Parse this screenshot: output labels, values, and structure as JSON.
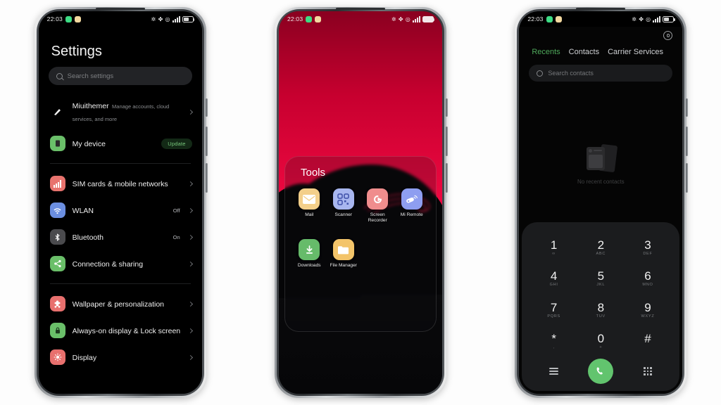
{
  "background_color": "#fdfdfd",
  "status_bar": {
    "time": "22:03",
    "left_icons": [
      "phone-notification-icon",
      "app-notification-icon"
    ],
    "right_icons": [
      "bluetooth-icon",
      "nfc-icon",
      "dnd-icon",
      "signal-bars-icon",
      "battery-icon"
    ]
  },
  "phone1": {
    "title": "Settings",
    "search": {
      "placeholder": "Search settings",
      "icon": "search-icon"
    },
    "groups": [
      {
        "items": [
          {
            "icon": "miuithemer-icon",
            "icon_color": "transparent",
            "label": "Miuithemer",
            "sub": "Manage accounts, cloud services, and more",
            "value": "",
            "badge": "",
            "chevron": true
          },
          {
            "icon": "my-device-icon",
            "icon_color": "#6abf69",
            "label": "My device",
            "sub": "",
            "value": "",
            "badge": "Update",
            "chevron": false
          }
        ]
      },
      {
        "items": [
          {
            "icon": "sim-cards-icon",
            "icon_color": "#e8736e",
            "label": "SIM cards & mobile networks",
            "sub": "",
            "value": "",
            "badge": "",
            "chevron": true
          },
          {
            "icon": "wlan-icon",
            "icon_color": "#6b8ee0",
            "label": "WLAN",
            "sub": "",
            "value": "Off",
            "badge": "",
            "chevron": true
          },
          {
            "icon": "bluetooth-icon",
            "icon_color": "#4a4a4d",
            "label": "Bluetooth",
            "sub": "",
            "value": "On",
            "badge": "",
            "chevron": true
          },
          {
            "icon": "connection-sharing-icon",
            "icon_color": "#6abf69",
            "label": "Connection & sharing",
            "sub": "",
            "value": "",
            "badge": "",
            "chevron": true
          }
        ]
      },
      {
        "items": [
          {
            "icon": "wallpaper-icon",
            "icon_color": "#e8706e",
            "label": "Wallpaper & personalization",
            "sub": "",
            "value": "",
            "badge": "",
            "chevron": true
          },
          {
            "icon": "lock-screen-icon",
            "icon_color": "#6abf69",
            "label": "Always-on display & Lock screen",
            "sub": "",
            "value": "",
            "badge": "",
            "chevron": true
          },
          {
            "icon": "display-icon",
            "icon_color": "#e8706e",
            "label": "Display",
            "sub": "",
            "value": "",
            "badge": "",
            "chevron": true
          }
        ]
      }
    ]
  },
  "phone2": {
    "wallpaper": {
      "top_color": "#8a0020",
      "mid_color": "#ec0840",
      "bottom_color": "#060608"
    },
    "folder": {
      "title": "Tools",
      "apps": [
        {
          "name": "Mail",
          "icon": "mail-icon",
          "color": "#f3cf8a"
        },
        {
          "name": "Scanner",
          "icon": "scanner-icon",
          "color": "#a8b6ef"
        },
        {
          "name": "Screen Recorder",
          "icon": "screen-recorder-icon",
          "color": "#f08d8d"
        },
        {
          "name": "Mi Remote",
          "icon": "mi-remote-icon",
          "color": "#8e9ef0"
        },
        {
          "name": "Downloads",
          "icon": "downloads-icon",
          "color": "#66bb6a"
        },
        {
          "name": "File Manager",
          "icon": "file-manager-icon",
          "color": "#f3c46a"
        }
      ]
    }
  },
  "phone3": {
    "settings_icon": "gear-icon",
    "tabs": [
      {
        "label": "Recents",
        "active": true
      },
      {
        "label": "Contacts",
        "active": false
      },
      {
        "label": "Carrier Services",
        "active": false
      }
    ],
    "search": {
      "placeholder": "Search contacts",
      "icon": "search-icon"
    },
    "empty_state": {
      "text": "No recent contacts",
      "icon": "contact-cards-icon"
    },
    "keypad": [
      {
        "num": "1",
        "sub": "∞"
      },
      {
        "num": "2",
        "sub": "ABC"
      },
      {
        "num": "3",
        "sub": "DEF"
      },
      {
        "num": "4",
        "sub": "GHI"
      },
      {
        "num": "5",
        "sub": "JKL"
      },
      {
        "num": "6",
        "sub": "MNO"
      },
      {
        "num": "7",
        "sub": "PQRS"
      },
      {
        "num": "8",
        "sub": "TUV"
      },
      {
        "num": "9",
        "sub": "WXYZ"
      },
      {
        "num": "*",
        "sub": ","
      },
      {
        "num": "0",
        "sub": "+"
      },
      {
        "num": "#",
        "sub": ""
      }
    ],
    "bottom_bar": {
      "menu_icon": "hamburger-menu-icon",
      "call_icon": "call-icon",
      "dialpad_icon": "dialpad-icon",
      "call_color": "#62c46e"
    }
  }
}
